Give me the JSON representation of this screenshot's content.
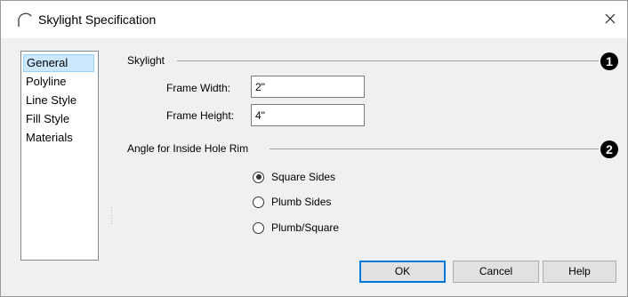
{
  "window": {
    "title": "Skylight Specification",
    "title_icon": "skylight-arc-icon",
    "close_glyph": "×"
  },
  "sidebar": {
    "items": [
      {
        "label": "General",
        "selected": true
      },
      {
        "label": "Polyline",
        "selected": false
      },
      {
        "label": "Line Style",
        "selected": false
      },
      {
        "label": "Fill Style",
        "selected": false
      },
      {
        "label": "Materials",
        "selected": false
      }
    ]
  },
  "skylight_group": {
    "label": "Skylight",
    "badge": "1",
    "frame_width_label": "Frame Width:",
    "frame_width_value": "2\"",
    "frame_height_label": "Frame Height:",
    "frame_height_value": "4\""
  },
  "angle_group": {
    "label": "Angle for Inside Hole Rim",
    "badge": "2",
    "options": [
      {
        "label": "Square Sides",
        "selected": true
      },
      {
        "label": "Plumb Sides",
        "selected": false
      },
      {
        "label": "Plumb/Square",
        "selected": false
      }
    ]
  },
  "buttons": {
    "ok": "OK",
    "cancel": "Cancel",
    "help": "Help"
  },
  "colors": {
    "selection_bg": "#cce8ff",
    "default_button_border": "#0078d7",
    "badge": "#000000"
  }
}
